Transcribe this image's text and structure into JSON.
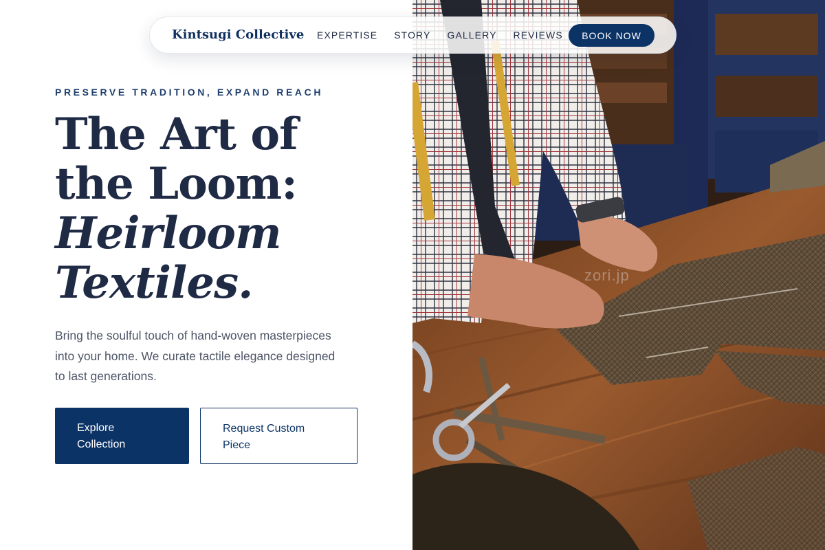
{
  "nav": {
    "brand": "Kintsugi Collective",
    "links": [
      "EXPERTISE",
      "STORY",
      "GALLERY",
      "REVIEWS"
    ],
    "cta": "BOOK NOW"
  },
  "hero": {
    "eyebrow": "PRESERVE TRADITION, EXPAND REACH",
    "headline_lines": [
      "The Art of",
      "the Loom:",
      "Heirloom",
      "Textiles."
    ],
    "description": "Bring the soulful touch of hand-woven masterpieces into your home. We curate tactile elegance designed to last generations.",
    "primary_button": [
      "Explore",
      "Collection"
    ],
    "secondary_button": [
      "Request Custom",
      "Piece"
    ]
  },
  "image": {
    "watermark": "zori.jp",
    "subject": "tailor-cutting-tweed-photo"
  },
  "colors": {
    "brand_navy": "#0c3366",
    "headline": "#1f2a44",
    "body_text": "#4d5566",
    "wood": "#8a4f27"
  }
}
